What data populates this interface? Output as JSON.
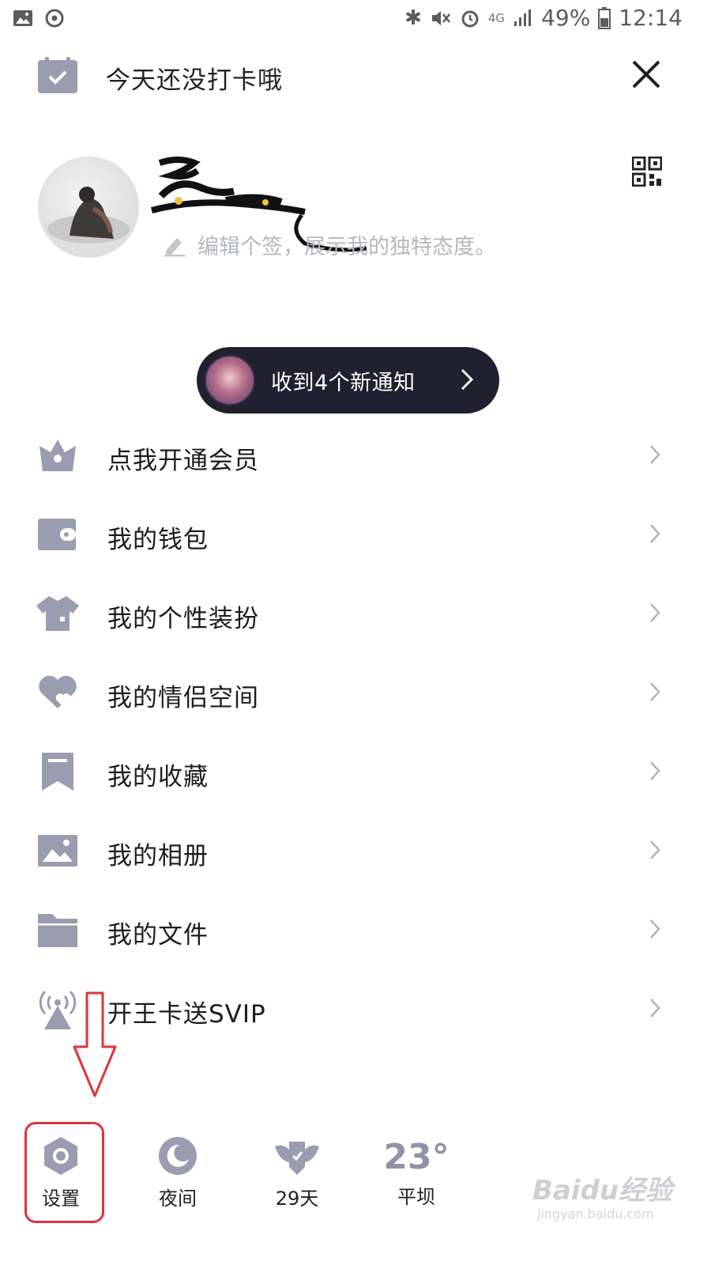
{
  "status_bar": {
    "battery": "49%",
    "time": "12:14",
    "network": "4G"
  },
  "header": {
    "checkin_text": "今天还没打卡哦"
  },
  "profile": {
    "signature_placeholder": "编辑个签，展示我的独特态度。"
  },
  "notification": {
    "text": "收到4个新通知"
  },
  "menu": [
    {
      "label": "点我开通会员",
      "icon": "vip-icon"
    },
    {
      "label": "我的钱包",
      "icon": "wallet-icon"
    },
    {
      "label": "我的个性装扮",
      "icon": "shirt-icon"
    },
    {
      "label": "我的情侣空间",
      "icon": "heart-icon"
    },
    {
      "label": "我的收藏",
      "icon": "bookmark-icon"
    },
    {
      "label": "我的相册",
      "icon": "photo-icon"
    },
    {
      "label": "我的文件",
      "icon": "folder-icon"
    },
    {
      "label": "开王卡送SVIP",
      "icon": "signal-tower-icon"
    }
  ],
  "bottom_bar": {
    "settings_label": "设置",
    "night_label": "夜间",
    "days_label": "29天",
    "weather_temp": "23°",
    "weather_city": "平坝"
  },
  "watermark": {
    "brand": "Baidu经验",
    "url": "jingyan.baidu.com"
  },
  "colors": {
    "icon_gray": "#9a9db0",
    "annotation_red": "#e0333a",
    "pill_bg": "#20202e"
  }
}
